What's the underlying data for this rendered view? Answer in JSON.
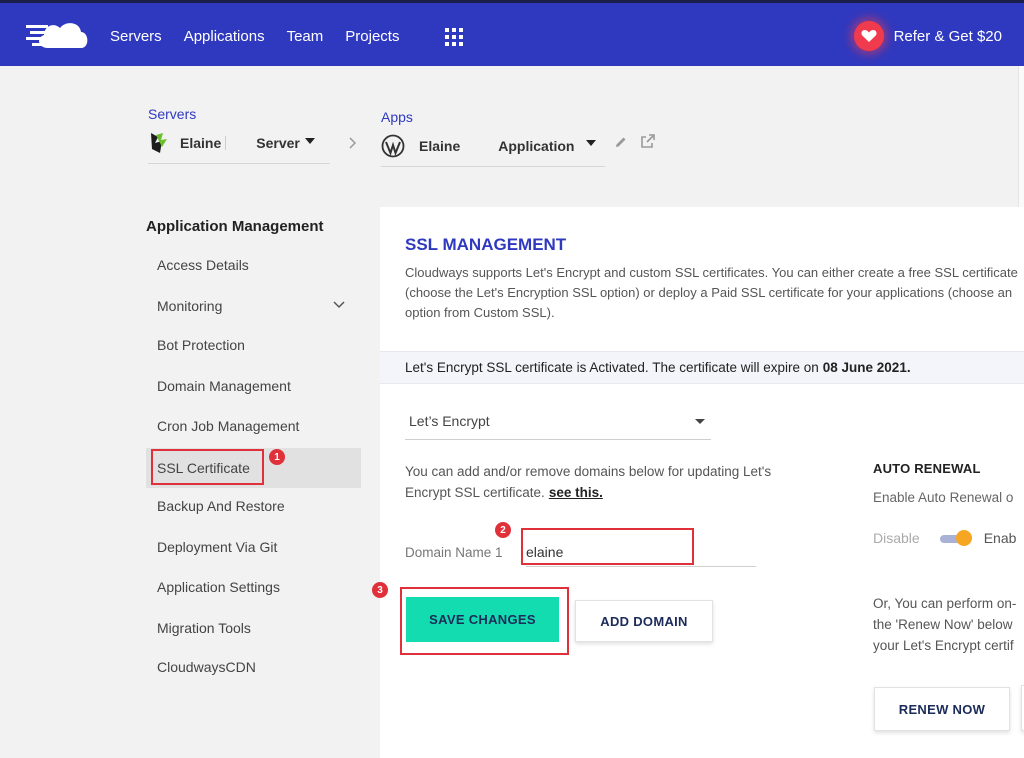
{
  "topbar": {
    "nav": [
      "Servers",
      "Applications",
      "Team",
      "Projects"
    ],
    "refer_label": "Refer & Get $20"
  },
  "breadcrumb": {
    "servers_label": "Servers",
    "server_name": "Elaine",
    "server_type": "Server",
    "apps_label": "Apps",
    "app_name": "Elaine",
    "app_type": "Application"
  },
  "sidebar": {
    "title": "Application Management",
    "items": [
      {
        "label": "Access Details"
      },
      {
        "label": "Monitoring"
      },
      {
        "label": "Bot Protection"
      },
      {
        "label": "Domain Management"
      },
      {
        "label": "Cron Job Management"
      },
      {
        "label": "SSL Certificate"
      },
      {
        "label": "Backup And Restore"
      },
      {
        "label": "Deployment Via Git"
      },
      {
        "label": "Application Settings"
      },
      {
        "label": "Migration Tools"
      },
      {
        "label": "CloudwaysCDN"
      }
    ]
  },
  "annotations": [
    "1",
    "2",
    "3"
  ],
  "ssl": {
    "title": "SSL MANAGEMENT",
    "description": "Cloudways supports Let's Encrypt and custom SSL certificates. You can either create a free SSL certificate (choose the Let's Encryption SSL option) or deploy a Paid SSL certificate for your applications (choose an option from Custom SSL).",
    "notice_text": "Let's Encrypt SSL certificate is Activated. The certificate will expire on",
    "notice_date": "08 June 2021.",
    "selected_option": "Let’s Encrypt",
    "domains_desc": "You can add and/or remove domains below for updating Let's Encrypt SSL certificate.",
    "see_this": "see this.",
    "domain_label": "Domain Name 1",
    "domain_value": "elaine",
    "save_label": "SAVE CHANGES",
    "add_domain_label": "ADD DOMAIN"
  },
  "auto_renewal": {
    "title": "AUTO RENEWAL",
    "desc": "Enable Auto Renewal o",
    "disable_label": "Disable",
    "enable_label": "Enab",
    "renew_desc_1": "Or, You can perform on-",
    "renew_desc_2": "the 'Renew Now' below",
    "renew_desc_3": "your Let's Encrypt certif",
    "renew_now_label": "RENEW NOW"
  },
  "colors": {
    "brand": "#2f39bf",
    "save_button": "#13dcb0",
    "annotation": "#e0303a",
    "toggle_knob": "#f5a623"
  }
}
